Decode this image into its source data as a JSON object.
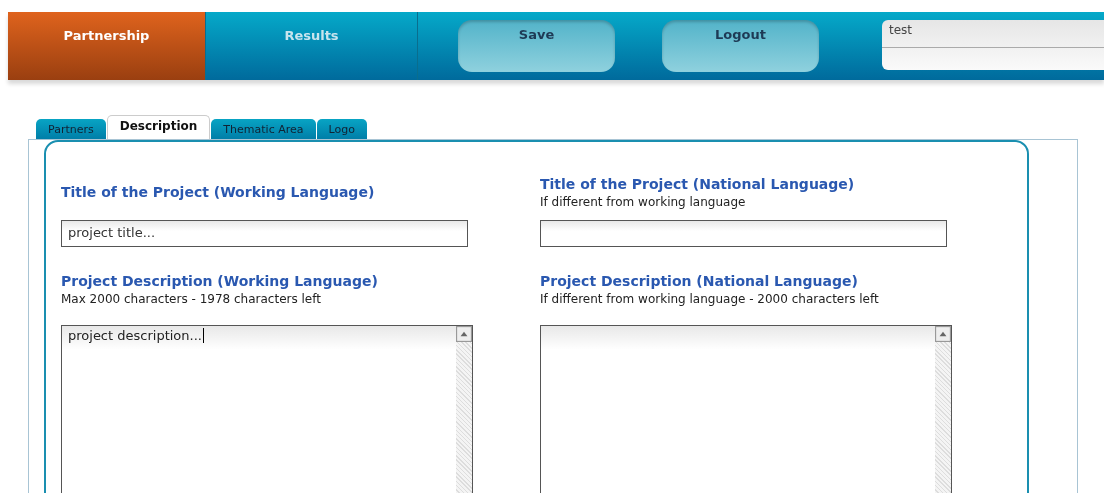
{
  "nav": [
    {
      "label": "Partnership",
      "selected": true
    },
    {
      "label": "Results",
      "selected": false
    }
  ],
  "buttons": [
    "Save",
    "Logout"
  ],
  "user_field": {
    "value": "test"
  },
  "tabs": [
    {
      "label": "Partners",
      "selected": false
    },
    {
      "label": "Description",
      "selected": true
    },
    {
      "label": "Thematic Area",
      "selected": false
    },
    {
      "label": "Logo",
      "selected": false
    }
  ],
  "columns": [
    {
      "fields": [
        {
          "kind": "input",
          "heading": "Title of the Project (Working Language)",
          "value": "project title...",
          "focused": false
        },
        {
          "kind": "textarea",
          "heading": "Project Description (Working Language)",
          "hint": "Max 2000 characters - 1978 characters left",
          "value": "project description...",
          "focused": true
        }
      ]
    },
    {
      "fields": [
        {
          "kind": "input",
          "heading": "Title of the Project (National Language)",
          "hint": "If different from working language",
          "focused": false
        },
        {
          "kind": "textarea",
          "heading": "Project Description (National Language)",
          "hint": "If different from working language - 2000 characters left",
          "focused": false
        }
      ]
    }
  ]
}
